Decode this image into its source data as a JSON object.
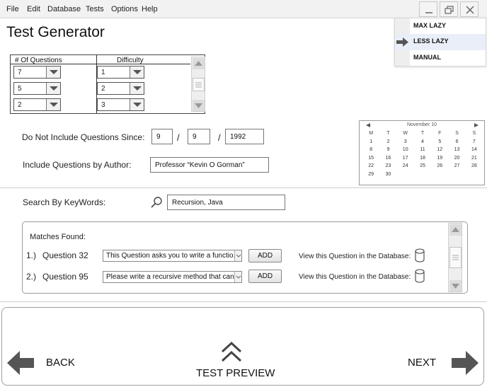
{
  "menubar": {
    "items": [
      "File",
      "Edit",
      "Database",
      "Tests",
      "Options",
      "Help"
    ]
  },
  "app": {
    "title": "Test Generator"
  },
  "mode_menu": {
    "options": [
      "MAX LAZY",
      "LESS LAZY",
      "MANUAL"
    ],
    "selected": "LESS LAZY"
  },
  "question_grid": {
    "headers": {
      "count": "# Of Questions",
      "difficulty": "Difficulty"
    },
    "rows": [
      {
        "count": "7",
        "difficulty": "1"
      },
      {
        "count": "5",
        "difficulty": "2"
      },
      {
        "count": "2",
        "difficulty": "3"
      }
    ]
  },
  "filters": {
    "since_label": "Do Not Include Questions Since:",
    "since_month": "9",
    "since_day": "9",
    "since_year": "1992",
    "date_sep": "/",
    "author_label": "Include Questions by Author:",
    "author_value": "Professor “Kevin O Gorman”"
  },
  "calendar": {
    "month_label": "November 10",
    "weekdays": [
      "M",
      "T",
      "W",
      "T",
      "F",
      "S",
      "S"
    ],
    "days": [
      "1",
      "2",
      "3",
      "4",
      "5",
      "6",
      "7",
      "8",
      "9",
      "10",
      "11",
      "12",
      "13",
      "14",
      "15",
      "16",
      "17",
      "18",
      "19",
      "20",
      "21",
      "22",
      "23",
      "24",
      "25",
      "26",
      "27",
      "28",
      "29",
      "30"
    ]
  },
  "search": {
    "label": "Search By KeyWords:",
    "value": "Recursion, Java"
  },
  "matches": {
    "title": "Matches Found:",
    "items": [
      {
        "index": "1.)",
        "question": "Question 32",
        "preview": "This Question asks you to write a functio...",
        "add_label": "ADD",
        "db_label": "View this Question in the Database:"
      },
      {
        "index": "2.)",
        "question": "Question 95",
        "preview": "Please write a recursive method that can...",
        "add_label": "ADD",
        "db_label": "View this Question in the Database:"
      }
    ]
  },
  "bottom_nav": {
    "back": "BACK",
    "preview": "TEST PREVIEW",
    "next": "NEXT"
  }
}
